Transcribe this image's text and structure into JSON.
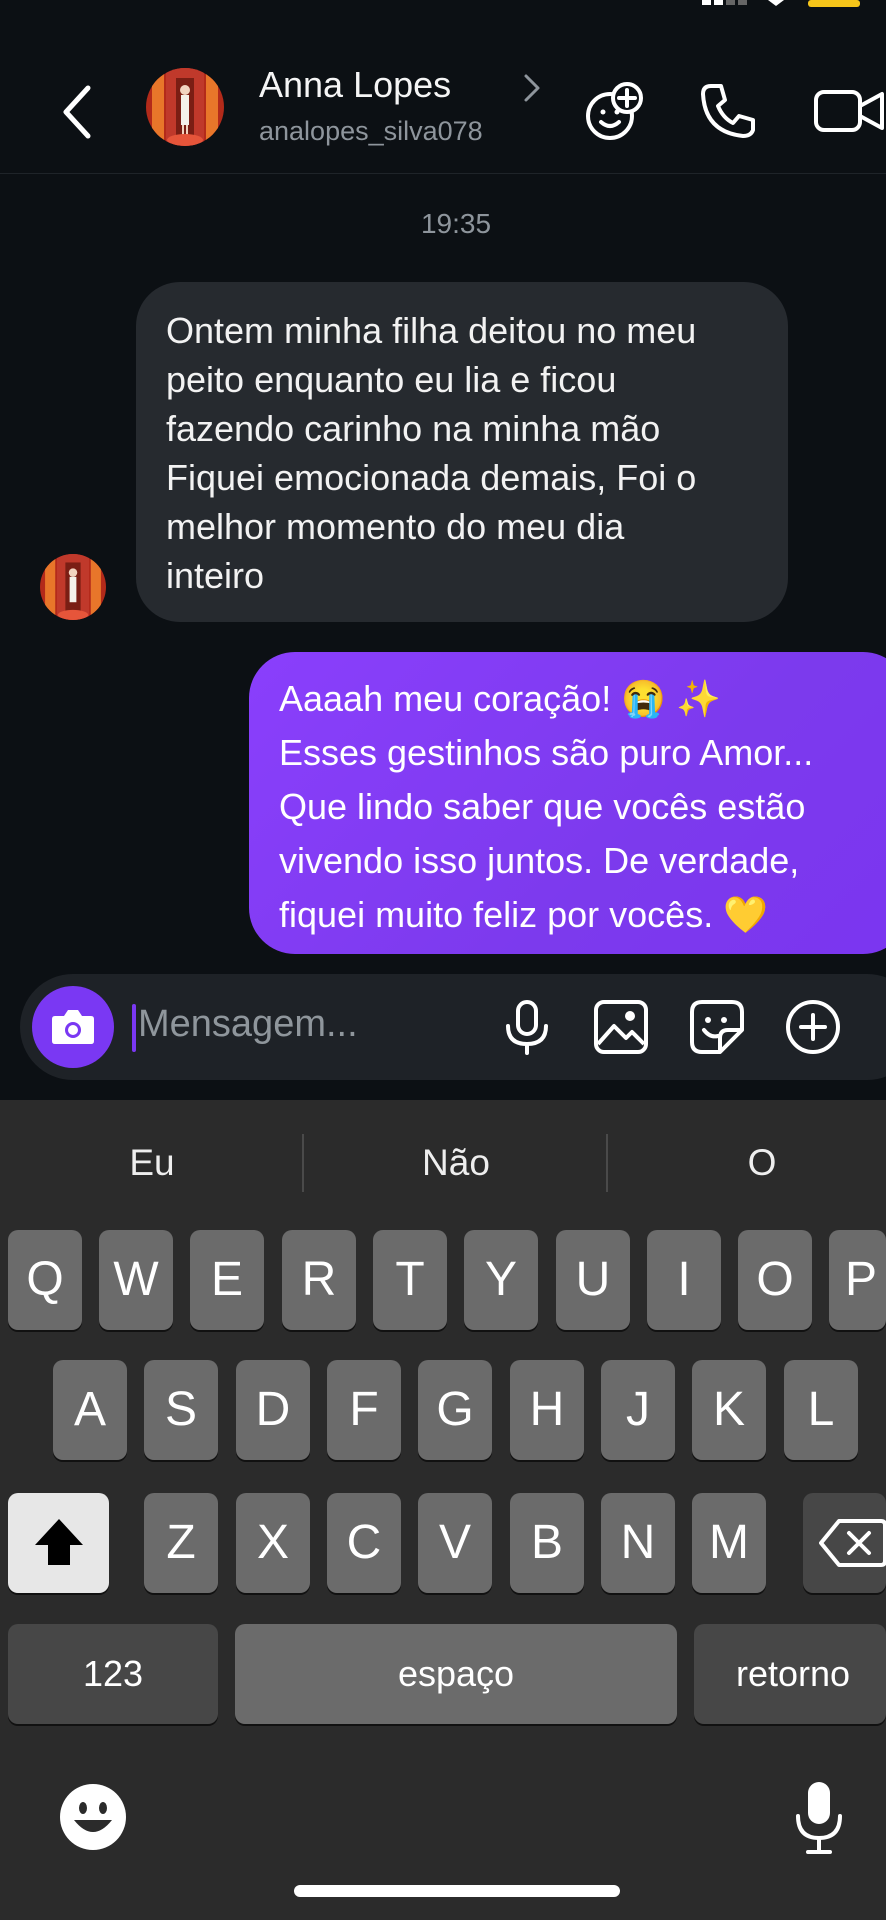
{
  "header": {
    "name": "Anna Lopes",
    "handle": "analopes_silva078"
  },
  "thread": {
    "timestamp": "19:35",
    "messages": [
      {
        "direction": "incoming",
        "lines": [
          "Ontem minha filha deitou no meu",
          "peito enquanto eu lia e ficou",
          "fazendo carinho na minha mão",
          "Fiquei emocionada demais, Foi o",
          "melhor momento do meu dia",
          "inteiro"
        ]
      },
      {
        "direction": "outgoing",
        "lines": [
          "Aaaah meu coração! 😭 ✨",
          "Esses gestinhos são puro Amor...",
          "Que lindo saber que vocês estão",
          "vivendo isso juntos. De verdade,",
          "fiquei muito feliz por vocês. 💛"
        ]
      }
    ]
  },
  "composer": {
    "placeholder": "Mensagem...",
    "accent": "#7a38f3"
  },
  "keyboard": {
    "suggestions": [
      "Eu",
      "Não",
      "O"
    ],
    "row1": [
      "Q",
      "W",
      "E",
      "R",
      "T",
      "Y",
      "U",
      "I",
      "O",
      "P"
    ],
    "row2": [
      "A",
      "S",
      "D",
      "F",
      "G",
      "H",
      "J",
      "K",
      "L"
    ],
    "row3": [
      "Z",
      "X",
      "C",
      "V",
      "B",
      "N",
      "M"
    ],
    "numbers_label": "123",
    "space_label": "espaço",
    "return_label": "retorno"
  }
}
